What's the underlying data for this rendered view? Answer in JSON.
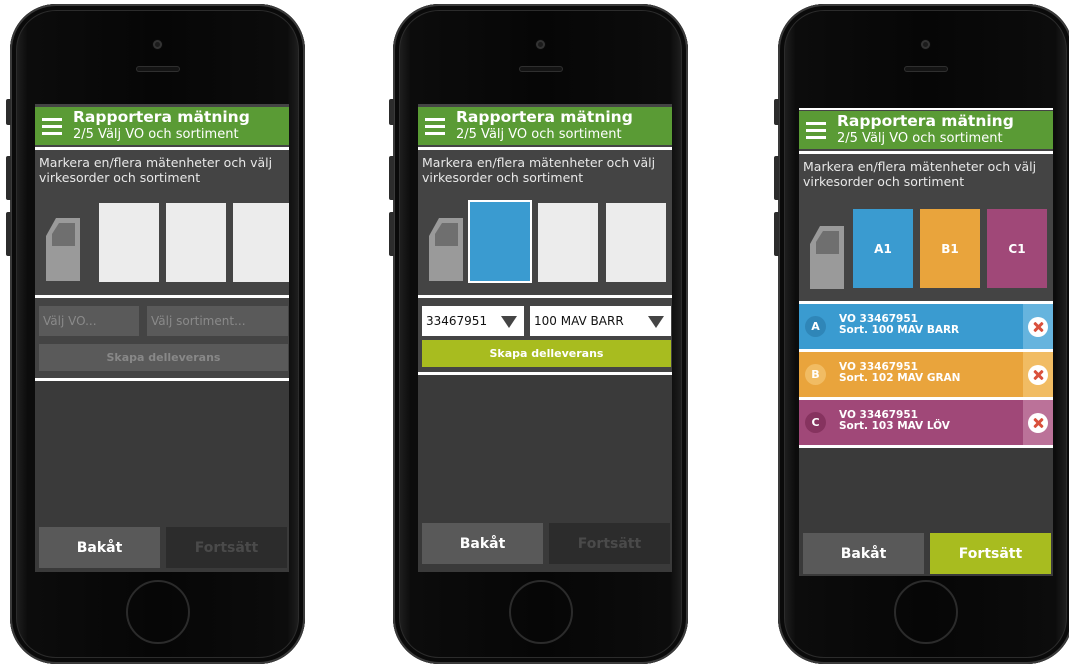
{
  "colors": {
    "header_green": "#5a9b35",
    "action_green": "#a8bc1f",
    "unit_blue": "#3a9bd0",
    "unit_orange": "#e9a43c",
    "unit_purple": "#a04878",
    "screen_bg": "#444444"
  },
  "phones": [
    {
      "header": {
        "title": "Rapportera mätning",
        "subtitle": "2/5 Välj VO och sortiment"
      },
      "instructions": "Markera en/flera mätenheter och välj virkesorder och sortiment",
      "units": [
        {
          "label": "",
          "state": "empty"
        },
        {
          "label": "",
          "state": "empty"
        },
        {
          "label": "",
          "state": "empty"
        }
      ],
      "vo_field": {
        "placeholder": "Välj VO...",
        "value": ""
      },
      "sortiment_field": {
        "placeholder": "Välj sortiment...",
        "value": ""
      },
      "create_button": {
        "label": "Skapa delleverans",
        "enabled": false
      },
      "back_button": "Bakåt",
      "next_button": {
        "label": "Fortsätt",
        "enabled": false
      }
    },
    {
      "header": {
        "title": "Rapportera mätning",
        "subtitle": "2/5 Välj VO och sortiment"
      },
      "instructions": "Markera en/flera mätenheter och välj virkesorder och sortiment",
      "units": [
        {
          "label": "",
          "state": "selected"
        },
        {
          "label": "",
          "state": "empty"
        },
        {
          "label": "",
          "state": "empty"
        }
      ],
      "vo_field": {
        "value": "33467951",
        "icon": "dropdown-arrow-icon"
      },
      "sortiment_field": {
        "value": "100 MAV BARR",
        "icon": "dropdown-arrow-icon"
      },
      "create_button": {
        "label": "Skapa delleverans",
        "enabled": true
      },
      "back_button": "Bakåt",
      "next_button": {
        "label": "Fortsätt",
        "enabled": false
      }
    },
    {
      "header": {
        "title": "Rapportera mätning",
        "subtitle": "2/5 Välj VO och sortiment"
      },
      "instructions": "Markera en/flera mätenheter och välj virkesorder och sortiment",
      "units": [
        {
          "label": "A1",
          "color": "#3a9bd0"
        },
        {
          "label": "B1",
          "color": "#e9a43c"
        },
        {
          "label": "C1",
          "color": "#a04878"
        }
      ],
      "deliveries": [
        {
          "badge": "A",
          "vo": "VO 33467951",
          "sort": "Sort. 100 MAV BARR",
          "color": "#3a9bd0",
          "dark": "#2f86b8",
          "light": "#66b4de"
        },
        {
          "badge": "B",
          "vo": "VO 33467951",
          "sort": "Sort. 102 MAV GRAN",
          "color": "#e9a43c",
          "dark": "#f1bc63",
          "light": "#f1bc63"
        },
        {
          "badge": "C",
          "vo": "VO 33467951",
          "sort": "Sort. 103 MAV LÖV",
          "color": "#a04878",
          "dark": "#86335f",
          "light": "#bb7299"
        }
      ],
      "back_button": "Bakåt",
      "next_button": {
        "label": "Fortsätt",
        "enabled": true
      }
    }
  ]
}
